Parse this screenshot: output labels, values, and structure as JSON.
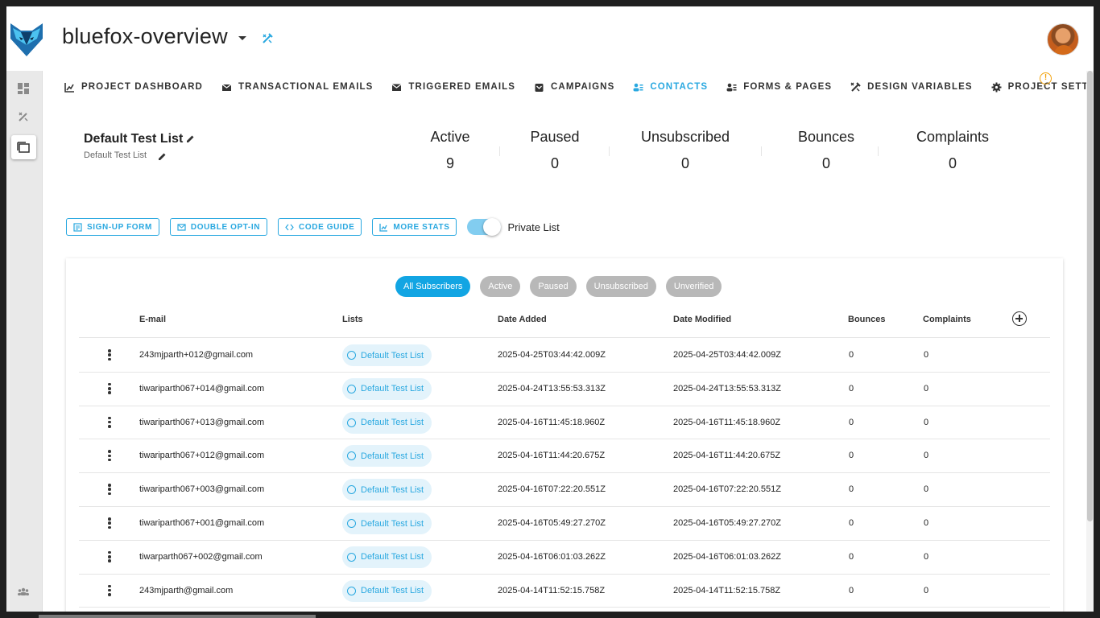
{
  "header": {
    "project_name": "bluefox-overview"
  },
  "nav": {
    "items": [
      {
        "label": "PROJECT DASHBOARD",
        "icon": "chart-icon"
      },
      {
        "label": "TRANSACTIONAL EMAILS",
        "icon": "mail-send-icon"
      },
      {
        "label": "TRIGGERED EMAILS",
        "icon": "mail-icon"
      },
      {
        "label": "CAMPAIGNS",
        "icon": "campaign-icon"
      },
      {
        "label": "CONTACTS",
        "icon": "contacts-icon",
        "active": true
      },
      {
        "label": "FORMS & PAGES",
        "icon": "forms-icon"
      },
      {
        "label": "DESIGN VARIABLES",
        "icon": "design-icon"
      },
      {
        "label": "PROJECT SETTINGS",
        "icon": "gear-icon"
      }
    ]
  },
  "list": {
    "title": "Default Test List",
    "subtitle": "Default Test List"
  },
  "stats": [
    {
      "label": "Active",
      "value": "9"
    },
    {
      "label": "Paused",
      "value": "0"
    },
    {
      "label": "Unsubscribed",
      "value": "0"
    },
    {
      "label": "Bounces",
      "value": "0"
    },
    {
      "label": "Complaints",
      "value": "0"
    }
  ],
  "actions": {
    "signup": "SIGN-UP FORM",
    "double_optin": "DOUBLE OPT-IN",
    "code_guide": "CODE GUIDE",
    "more_stats": "MORE STATS",
    "private_label": "Private List",
    "private_on": true
  },
  "filters": [
    {
      "label": "All Subscribers",
      "active": true
    },
    {
      "label": "Active",
      "active": false
    },
    {
      "label": "Paused",
      "active": false
    },
    {
      "label": "Unsubscribed",
      "active": false
    },
    {
      "label": "Unverified",
      "active": false
    }
  ],
  "table": {
    "columns": [
      "E-mail",
      "Lists",
      "Date Added",
      "Date Modified",
      "Bounces",
      "Complaints"
    ],
    "rows": [
      {
        "email": "243mjparth+012@gmail.com",
        "list": "Default Test List",
        "added": "2025-04-25T03:44:42.009Z",
        "modified": "2025-04-25T03:44:42.009Z",
        "bounces": "0",
        "complaints": "0"
      },
      {
        "email": "tiwariparth067+014@gmail.com",
        "list": "Default Test List",
        "added": "2025-04-24T13:55:53.313Z",
        "modified": "2025-04-24T13:55:53.313Z",
        "bounces": "0",
        "complaints": "0"
      },
      {
        "email": "tiwariparth067+013@gmail.com",
        "list": "Default Test List",
        "added": "2025-04-16T11:45:18.960Z",
        "modified": "2025-04-16T11:45:18.960Z",
        "bounces": "0",
        "complaints": "0"
      },
      {
        "email": "tiwariparth067+012@gmail.com",
        "list": "Default Test List",
        "added": "2025-04-16T11:44:20.675Z",
        "modified": "2025-04-16T11:44:20.675Z",
        "bounces": "0",
        "complaints": "0"
      },
      {
        "email": "tiwariparth067+003@gmail.com",
        "list": "Default Test List",
        "added": "2025-04-16T07:22:20.551Z",
        "modified": "2025-04-16T07:22:20.551Z",
        "bounces": "0",
        "complaints": "0"
      },
      {
        "email": "tiwariparth067+001@gmail.com",
        "list": "Default Test List",
        "added": "2025-04-16T05:49:27.270Z",
        "modified": "2025-04-16T05:49:27.270Z",
        "bounces": "0",
        "complaints": "0"
      },
      {
        "email": "tiwarparth067+002@gmail.com",
        "list": "Default Test List",
        "added": "2025-04-16T06:01:03.262Z",
        "modified": "2025-04-16T06:01:03.262Z",
        "bounces": "0",
        "complaints": "0"
      },
      {
        "email": "243mjparth@gmail.com",
        "list": "Default Test List",
        "added": "2025-04-14T11:52:15.758Z",
        "modified": "2025-04-14T11:52:15.758Z",
        "bounces": "0",
        "complaints": "0"
      }
    ]
  },
  "colors": {
    "accent": "#29a8e0",
    "warning": "#f2a20b",
    "chip_inactive": "#b8b8b8"
  }
}
